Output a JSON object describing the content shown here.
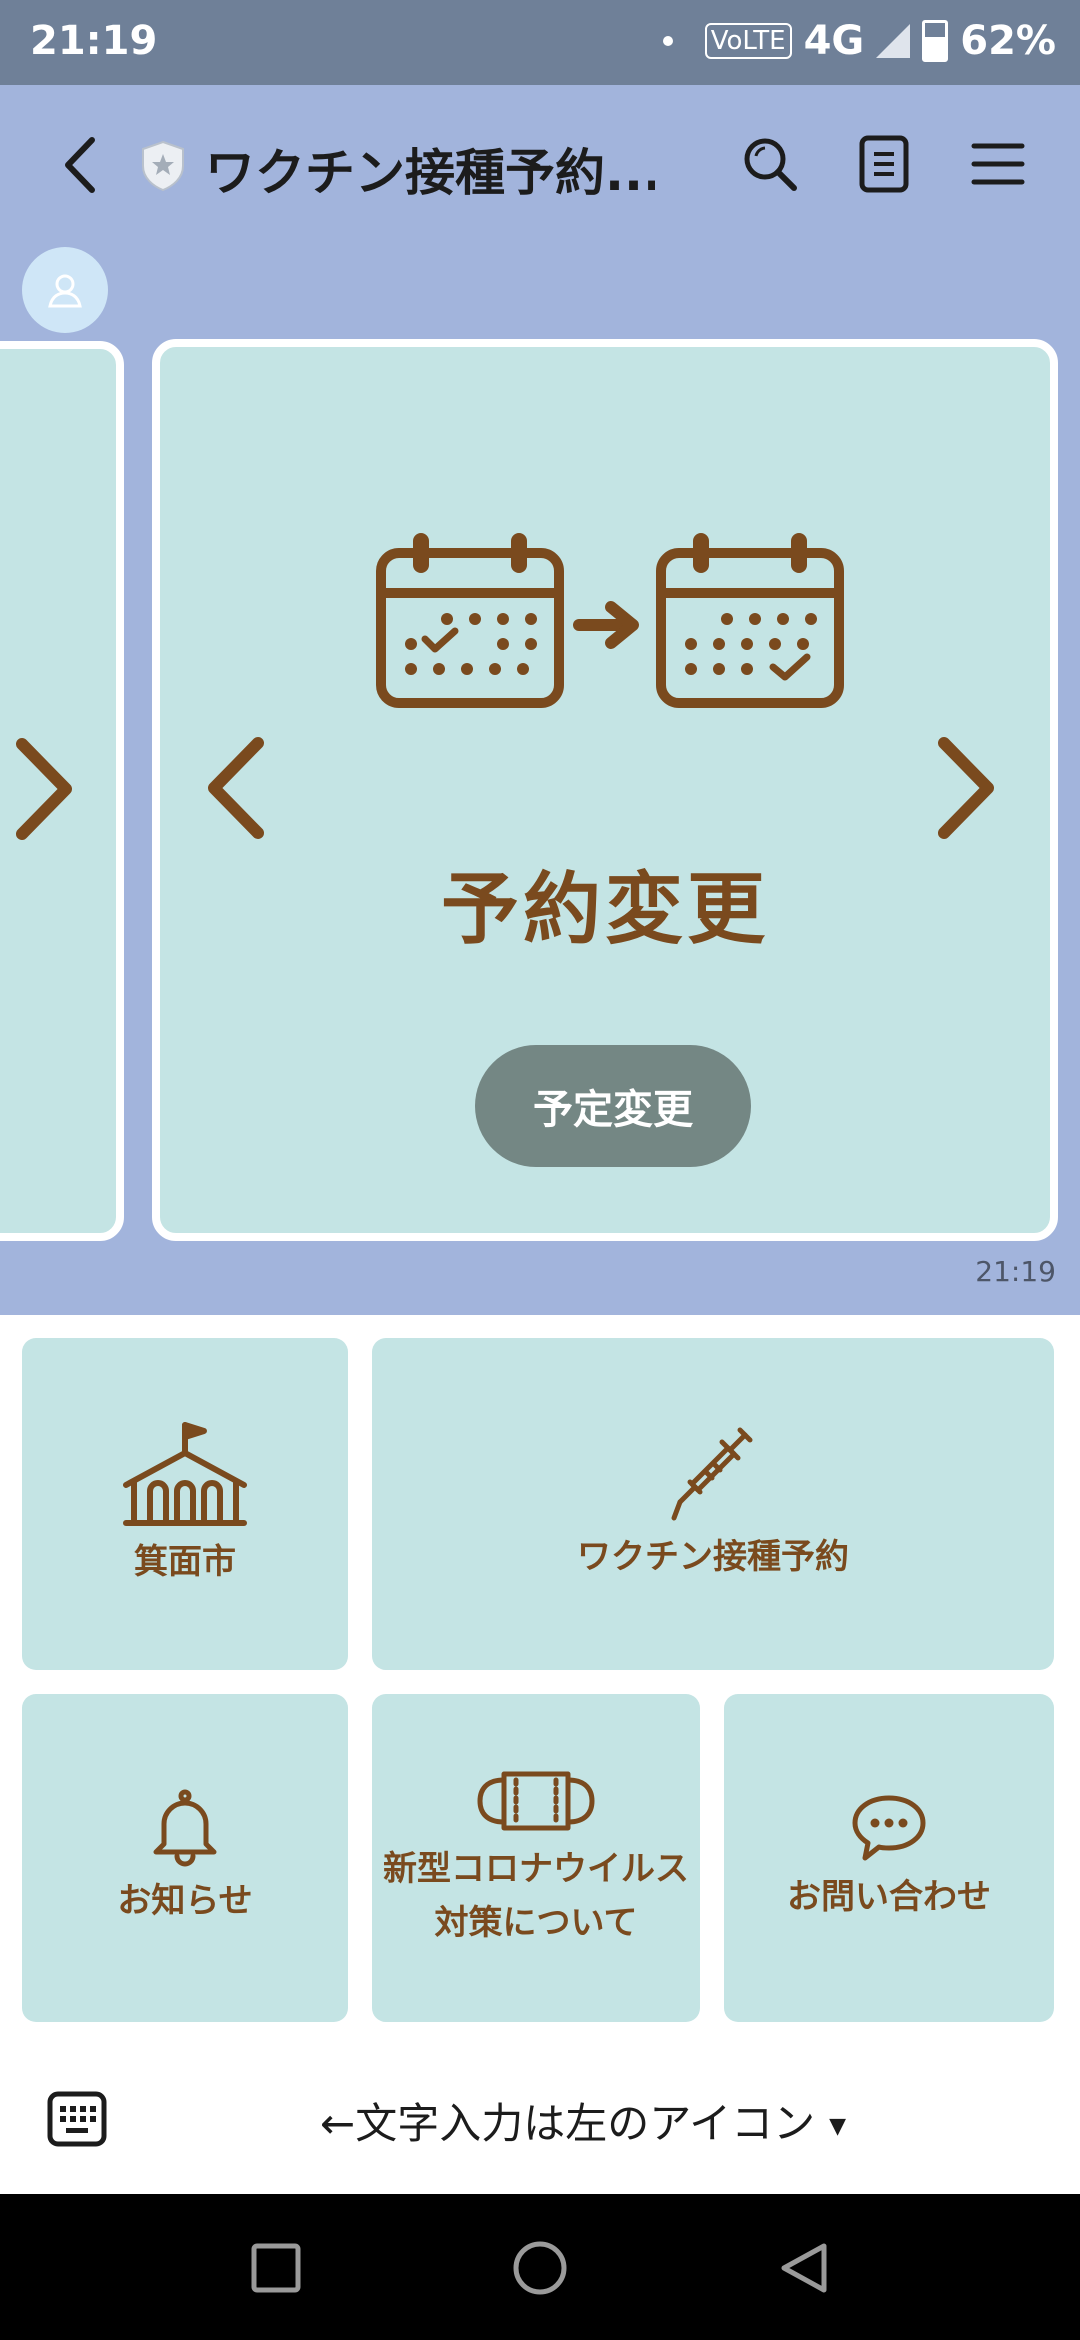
{
  "status_bar": {
    "time": "21:19",
    "volte": "VoLTE",
    "network": "4G",
    "battery": "62%",
    "icons": [
      "notification-dot-icon",
      "signal-icon",
      "battery-icon"
    ]
  },
  "header": {
    "title": "ワクチン接種予約...",
    "icons": [
      "back-icon",
      "shield-star-icon",
      "search-icon",
      "notes-icon",
      "menu-icon"
    ]
  },
  "message": {
    "card_title": "予約変更",
    "button_label": "予定変更",
    "time": "21:19",
    "icons": [
      "calendar-icon",
      "arrow-right-icon",
      "calendar-check-icon",
      "chevron-left-icon",
      "chevron-right-icon"
    ]
  },
  "rich_menu": {
    "items": [
      {
        "label": "箕面市",
        "icon": "school-icon"
      },
      {
        "label": "ワクチン接種予約",
        "icon": "syringe-icon"
      },
      {
        "label": "お知らせ",
        "icon": "bell-icon"
      },
      {
        "label_line1": "新型コロナウイルス",
        "label_line2": "対策について",
        "icon": "mask-icon"
      },
      {
        "label": "お問い合わせ",
        "icon": "chat-bubble-icon"
      }
    ]
  },
  "input_bar": {
    "label": "←文字入力は左のアイコン",
    "caret": "▼",
    "icon": "keyboard-icon"
  },
  "nav_bar": {
    "icons": [
      "recents-icon",
      "home-icon",
      "back-triangle-icon"
    ]
  },
  "colors": {
    "status_bar": "#6f8098",
    "chat_bg": "#a2b4dc",
    "card_bg": "#c4e4e4",
    "brown": "#7a4a1e",
    "button": "#748784"
  }
}
